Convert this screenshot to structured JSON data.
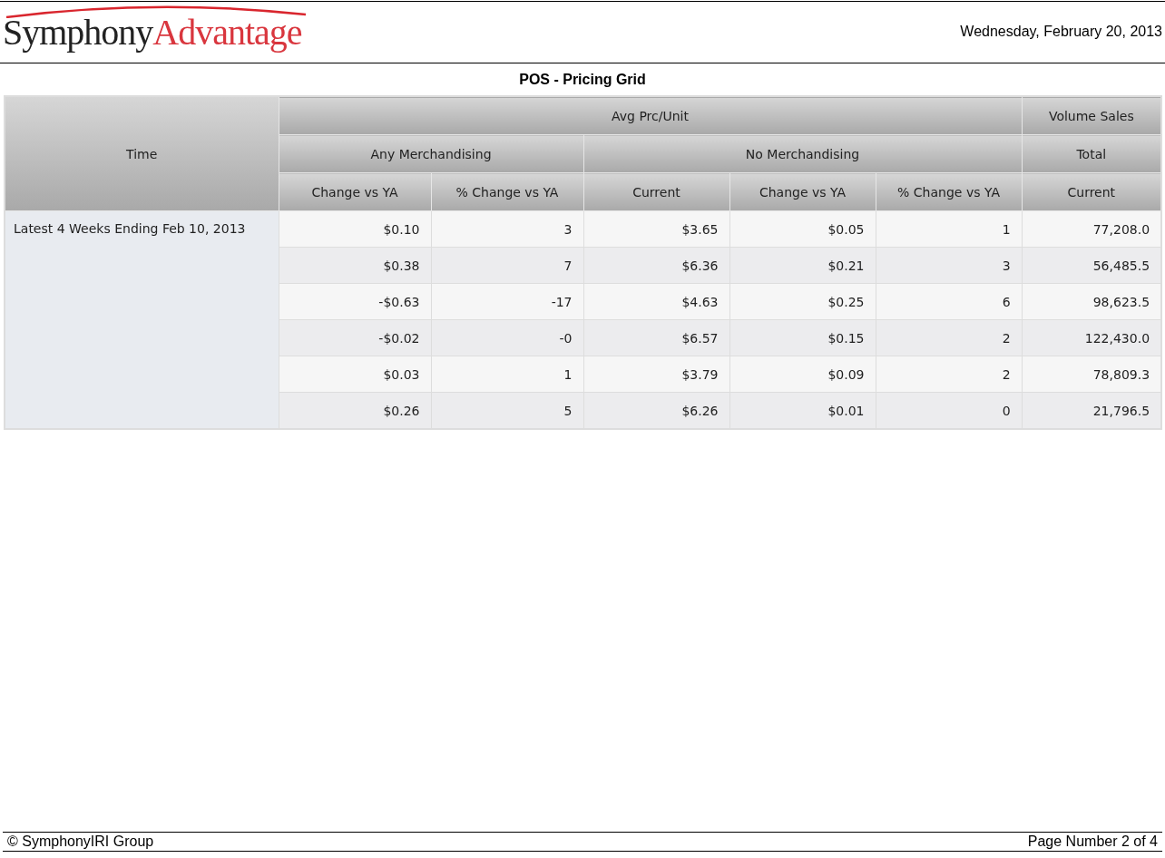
{
  "header": {
    "logo": {
      "first": "Symphony",
      "second": "Advantage"
    },
    "date": "Wednesday, February 20, 2013"
  },
  "title": "POS - Pricing Grid",
  "table": {
    "row_header": "Time",
    "column_groups": [
      {
        "label": "Avg Prc/Unit",
        "subgroups": [
          {
            "label": "Any Merchandising",
            "columns": [
              "Change vs YA",
              "% Change vs YA"
            ]
          },
          {
            "label": "No Merchandising",
            "columns": [
              "Current",
              "Change vs YA",
              "% Change vs YA"
            ]
          }
        ]
      },
      {
        "label": "Volume Sales",
        "subgroups": [
          {
            "label": "Total",
            "columns": [
              "Current"
            ]
          }
        ]
      }
    ],
    "rows": [
      [
        {
          "text": "Latest 4 Weeks Ending Feb 10, 2013",
          "rowspan": 6
        },
        "$0.10",
        "3",
        "$3.65",
        "$0.05",
        "1",
        "77,208.0"
      ],
      [
        "$0.38",
        "7",
        "$6.36",
        "$0.21",
        "3",
        "56,485.5"
      ],
      [
        "-$0.63",
        "-17",
        "$4.63",
        "$0.25",
        "6",
        "98,623.5"
      ],
      [
        "-$0.02",
        "-0",
        "$6.57",
        "$0.15",
        "2",
        "122,430.0"
      ],
      [
        "$0.03",
        "1",
        "$3.79",
        "$0.09",
        "2",
        "78,809.3"
      ],
      [
        "$0.26",
        "5",
        "$6.26",
        "$0.01",
        "0",
        "21,796.5"
      ]
    ]
  },
  "footer": {
    "copyright": "© SymphonyIRI Group",
    "page": "Page Number 2 of 4"
  }
}
